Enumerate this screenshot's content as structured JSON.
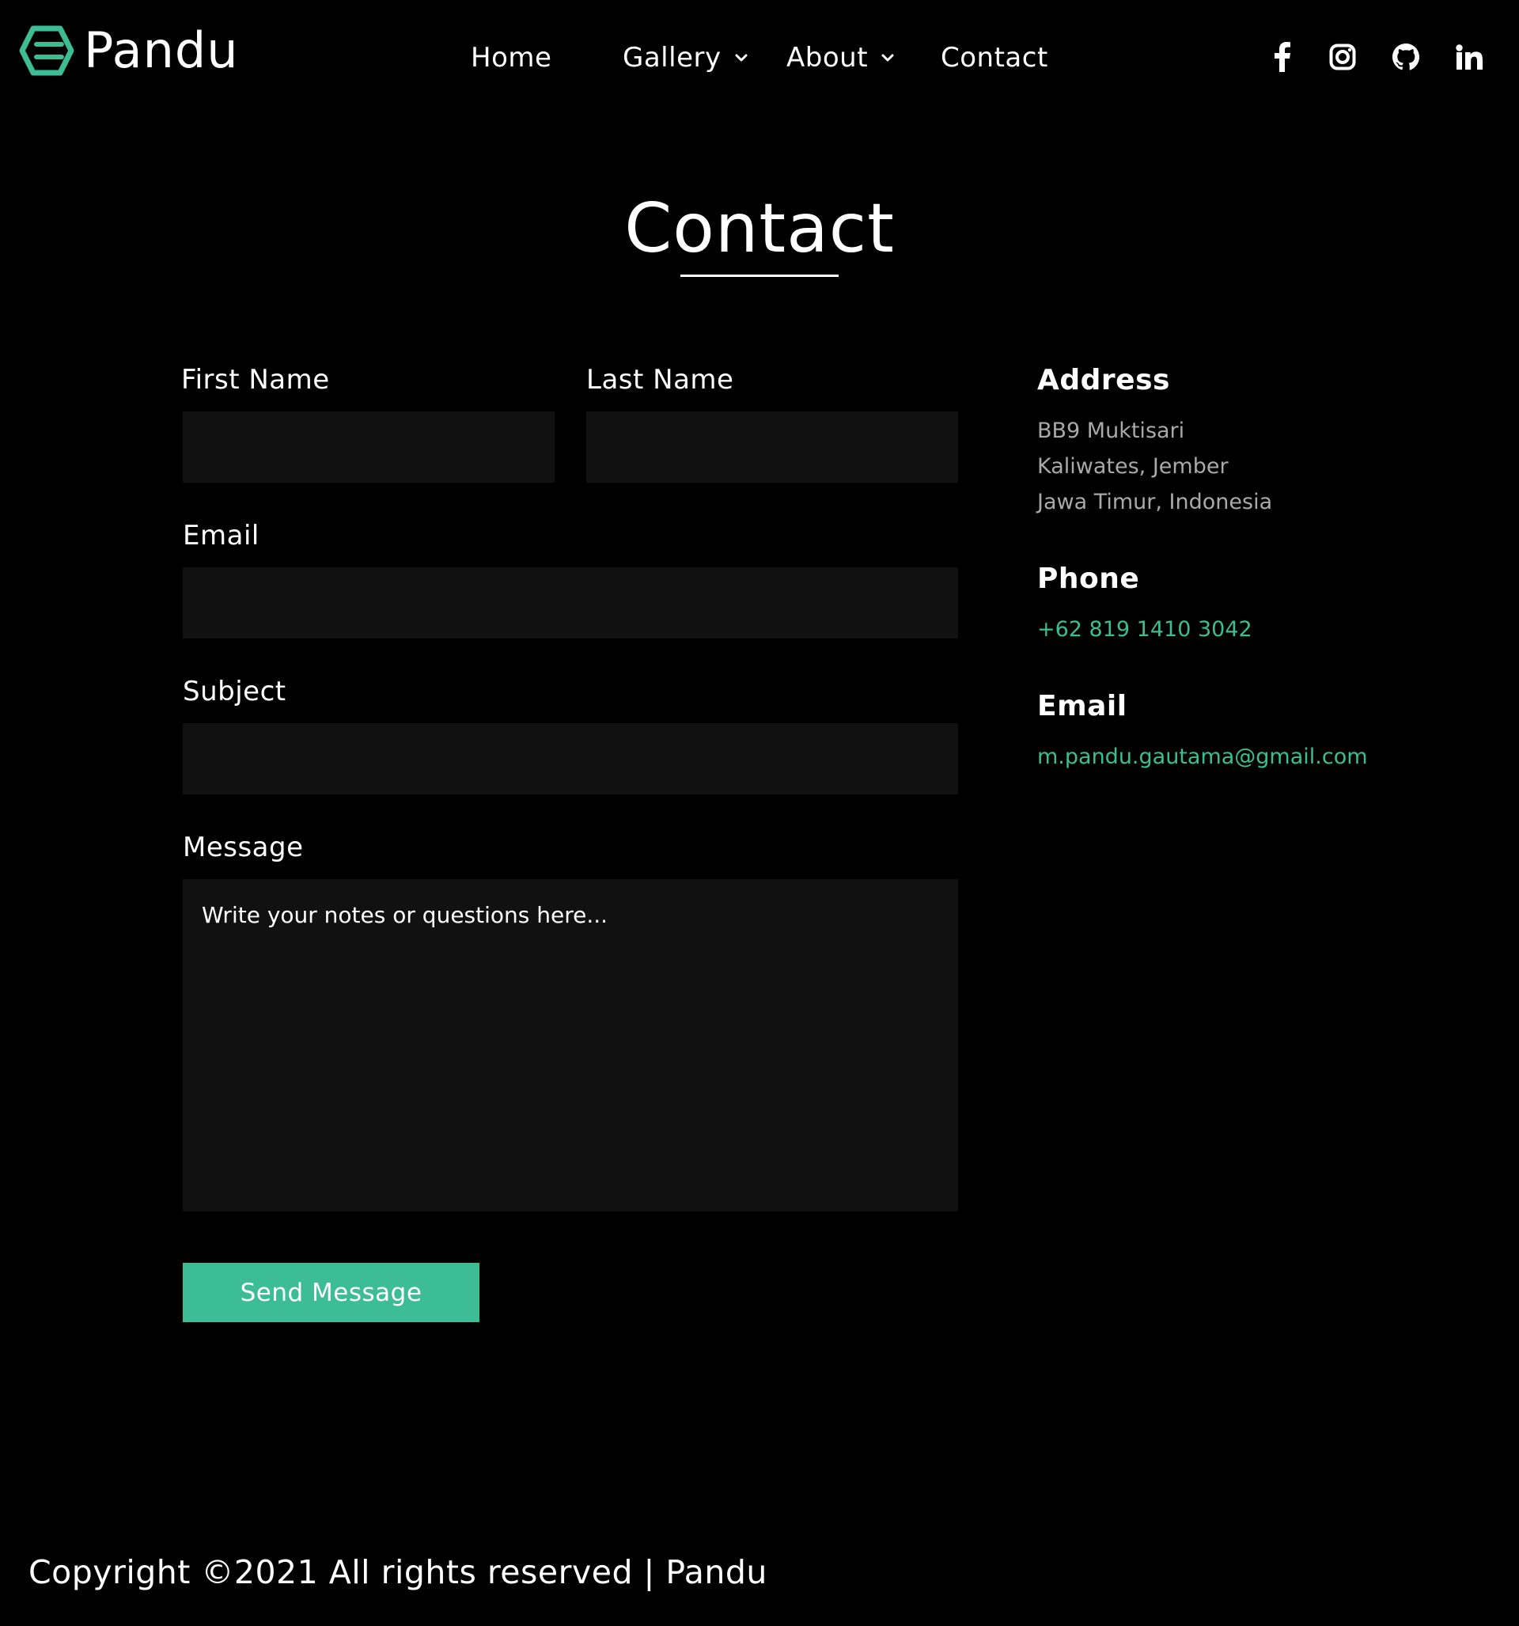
{
  "brand": {
    "name": "Pandu",
    "accent_color": "#3dbd93"
  },
  "nav": {
    "items": [
      {
        "label": "Home",
        "has_dropdown": false
      },
      {
        "label": "Gallery",
        "has_dropdown": true
      },
      {
        "label": "About",
        "has_dropdown": true
      },
      {
        "label": "Contact",
        "has_dropdown": false
      }
    ]
  },
  "social": [
    "facebook-icon",
    "instagram-icon",
    "github-icon",
    "linkedin-icon"
  ],
  "page": {
    "title": "Contact"
  },
  "form": {
    "first_name_label": "First Name",
    "first_name_value": "",
    "last_name_label": "Last Name",
    "last_name_value": "",
    "email_label": "Email",
    "email_value": "",
    "subject_label": "Subject",
    "subject_value": "",
    "message_label": "Message",
    "message_placeholder": "Write your notes or questions here...",
    "send_label": "Send Message"
  },
  "info": {
    "address_heading": "Address",
    "address_lines": [
      "BB9 Muktisari",
      "Kaliwates, Jember",
      "Jawa Timur, Indonesia"
    ],
    "phone_heading": "Phone",
    "phone": "+62 819 1410 3042",
    "email_heading": "Email",
    "email": "m.pandu.gautama@gmail.com"
  },
  "footer": {
    "copyright": "Copyright ©2021 All rights reserved | Pandu"
  }
}
